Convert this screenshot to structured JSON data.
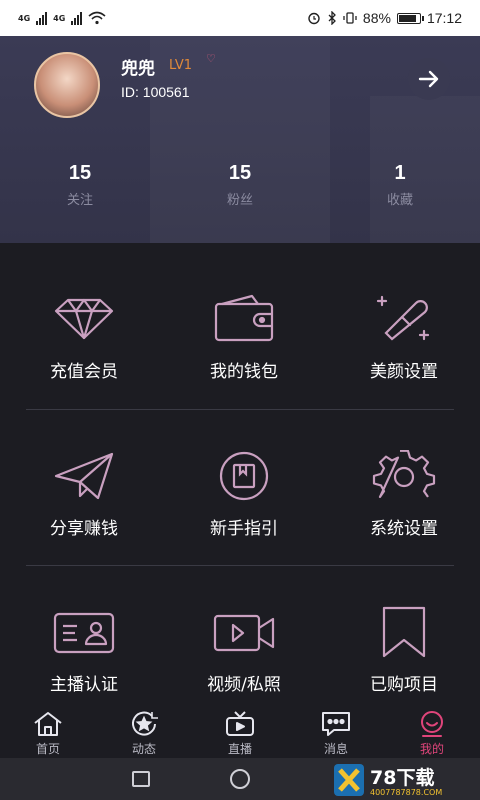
{
  "status_bar": {
    "network_left": "4G",
    "network_right": "4G",
    "battery_percent": "88%",
    "battery_level": 0.88,
    "time": "17:12"
  },
  "profile": {
    "username": "兜兜",
    "level": "LV1",
    "user_id": "ID: 100561",
    "stats": [
      {
        "value": "15",
        "label": "关注"
      },
      {
        "value": "15",
        "label": "粉丝"
      },
      {
        "value": "1",
        "label": "收藏"
      }
    ]
  },
  "menu": {
    "rows": [
      [
        {
          "label": "充值会员",
          "icon": "diamond-icon"
        },
        {
          "label": "我的钱包",
          "icon": "wallet-icon"
        },
        {
          "label": "美颜设置",
          "icon": "beauty-pen-icon"
        }
      ],
      [
        {
          "label": "分享赚钱",
          "icon": "paper-plane-icon"
        },
        {
          "label": "新手指引",
          "icon": "guide-book-icon"
        },
        {
          "label": "系统设置",
          "icon": "gear-icon"
        }
      ],
      [
        {
          "label": "主播认证",
          "icon": "id-card-icon"
        },
        {
          "label": "视频/私照",
          "icon": "video-camera-icon"
        },
        {
          "label": "已购项目",
          "icon": "bookmark-icon"
        }
      ]
    ]
  },
  "tabs": [
    {
      "label": "首页",
      "icon": "home-icon"
    },
    {
      "label": "动态",
      "icon": "moments-icon"
    },
    {
      "label": "直播",
      "icon": "tv-icon"
    },
    {
      "label": "消息",
      "icon": "chat-icon"
    },
    {
      "label": "我的",
      "icon": "profile-icon",
      "active": true
    }
  ],
  "watermark": {
    "brand": "78下载",
    "phone": "4007787878.COM"
  },
  "colors": {
    "accent": "#e0457b",
    "icon_stroke": "#c9a0c0",
    "level": "#e08a3a",
    "header_bg": "#3b3b55"
  }
}
